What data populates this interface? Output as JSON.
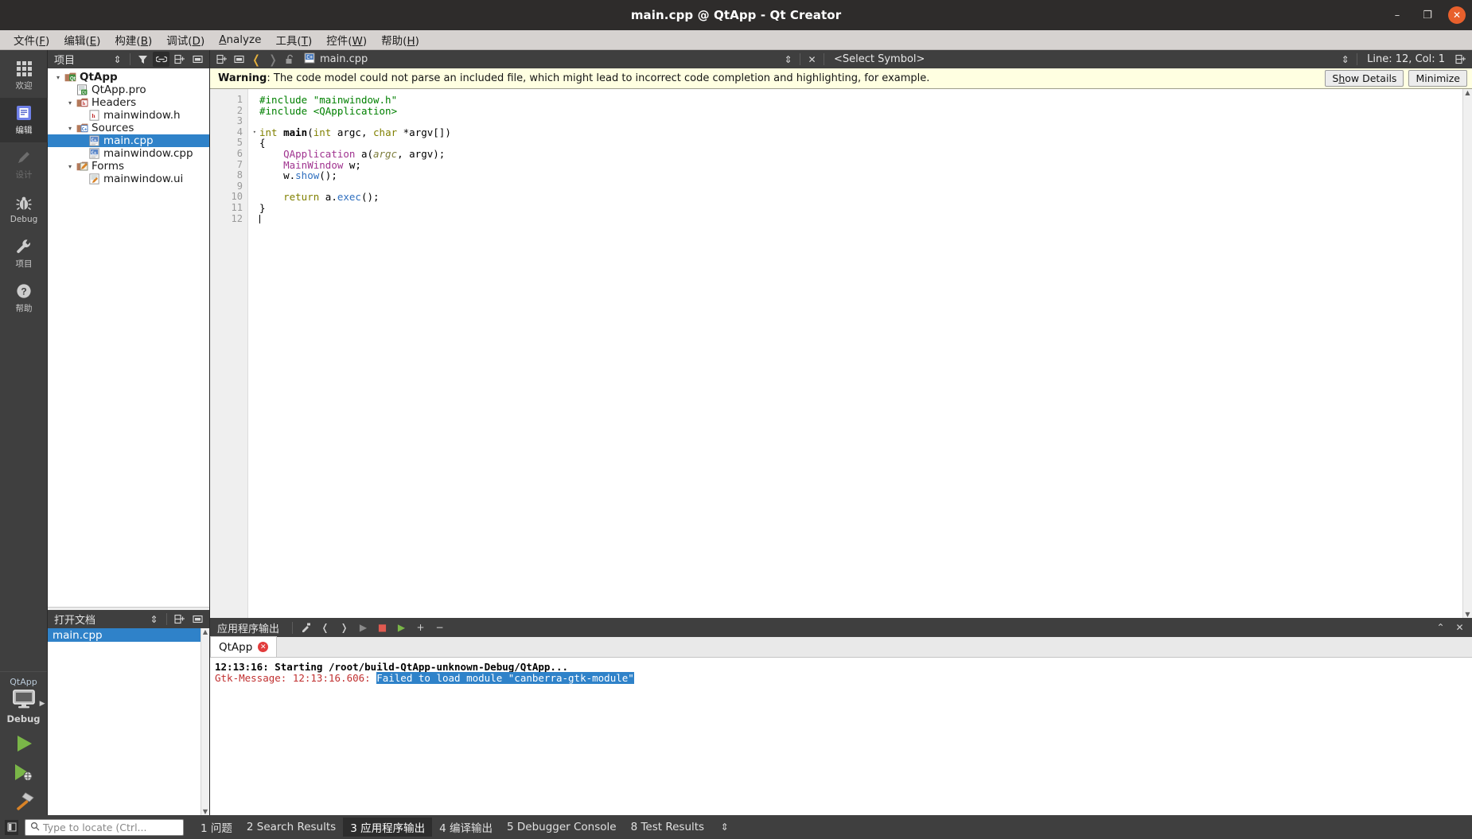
{
  "window": {
    "title": "main.cpp @ QtApp - Qt Creator",
    "minimize": "–",
    "maximize": "❐",
    "close": "✕"
  },
  "menubar": {
    "items": [
      {
        "pre": "文件(",
        "key": "F",
        "post": ")"
      },
      {
        "pre": "编辑(",
        "key": "E",
        "post": ")"
      },
      {
        "pre": "构建(",
        "key": "B",
        "post": ")"
      },
      {
        "pre": "调试(",
        "key": "D",
        "post": ")"
      },
      {
        "pre": "",
        "key": "A",
        "post": "nalyze"
      },
      {
        "pre": "工具(",
        "key": "T",
        "post": ")"
      },
      {
        "pre": "控件(",
        "key": "W",
        "post": ")"
      },
      {
        "pre": "帮助(",
        "key": "H",
        "post": ")"
      }
    ]
  },
  "modebar": {
    "modes": [
      {
        "label": "欢迎",
        "icon": "grid-icon",
        "state": "normal"
      },
      {
        "label": "编辑",
        "icon": "edit-document-icon",
        "state": "active"
      },
      {
        "label": "设计",
        "icon": "pencil-icon",
        "state": "disabled"
      },
      {
        "label": "Debug",
        "icon": "bug-icon",
        "state": "normal"
      },
      {
        "label": "项目",
        "icon": "wrench-icon",
        "state": "normal"
      },
      {
        "label": "帮助",
        "icon": "question-circle-icon",
        "state": "normal"
      }
    ],
    "kit": {
      "project_name": "QtApp",
      "build_config": "Debug",
      "target_icon": "monitor-icon",
      "run_icon": "run-play-icon",
      "debug_icon": "debug-play-icon",
      "build_icon": "hammer-icon"
    }
  },
  "project_dock": {
    "title": "项目",
    "toolbar": [
      {
        "name": "filter-sort-icon",
        "glyph": "⇕",
        "on": false
      },
      {
        "name": "filter-icon",
        "glyph": "▼",
        "on": false
      },
      {
        "name": "link-with-editor-icon",
        "glyph": "⛓",
        "on": true
      },
      {
        "name": "split-icon",
        "glyph": "⊟",
        "on": false
      },
      {
        "name": "close-dock-icon",
        "glyph": "⊡",
        "on": false
      }
    ],
    "tree": [
      {
        "label": "QtApp",
        "depth": 0,
        "twisty": "▾",
        "icon": "qt-project-icon",
        "bold": true,
        "selected": false
      },
      {
        "label": "QtApp.pro",
        "depth": 1,
        "twisty": "",
        "icon": "pro-file-icon",
        "bold": false,
        "selected": false
      },
      {
        "label": "Headers",
        "depth": 1,
        "twisty": "▾",
        "icon": "headers-folder-icon",
        "bold": false,
        "selected": false
      },
      {
        "label": "mainwindow.h",
        "depth": 2,
        "twisty": "",
        "icon": "header-file-icon",
        "bold": false,
        "selected": false
      },
      {
        "label": "Sources",
        "depth": 1,
        "twisty": "▾",
        "icon": "sources-folder-icon",
        "bold": false,
        "selected": false
      },
      {
        "label": "main.cpp",
        "depth": 2,
        "twisty": "",
        "icon": "cpp-file-icon",
        "bold": false,
        "selected": true
      },
      {
        "label": "mainwindow.cpp",
        "depth": 2,
        "twisty": "",
        "icon": "cpp-file-icon",
        "bold": false,
        "selected": false
      },
      {
        "label": "Forms",
        "depth": 1,
        "twisty": "▾",
        "icon": "forms-folder-icon",
        "bold": false,
        "selected": false
      },
      {
        "label": "mainwindow.ui",
        "depth": 2,
        "twisty": "",
        "icon": "ui-file-icon",
        "bold": false,
        "selected": false
      }
    ]
  },
  "open_documents": {
    "title": "打开文档",
    "toolbar": [
      {
        "name": "sort-icon",
        "glyph": "⇕"
      },
      {
        "name": "split-icon",
        "glyph": "⊟"
      },
      {
        "name": "close-dock-icon",
        "glyph": "⊡"
      }
    ],
    "items": [
      {
        "label": "main.cpp",
        "selected": true
      }
    ]
  },
  "editor_toolbar": {
    "split_icon": "⊟",
    "close_split_icon": "⊡",
    "back_icon": "❬",
    "forward_icon": "❭",
    "lock_icon": "lock-open-icon",
    "file_icon": "cpp-file-icon",
    "filename": "main.cpp",
    "file_dropdown_icon": "⇕",
    "close_file_icon": "✕",
    "symbol_selector": "<Select Symbol>",
    "symbol_dropdown_icon": "⇕",
    "line_col": "Line: 12, Col: 1",
    "split_right_icon": "⊟"
  },
  "warning_bar": {
    "label": "Warning",
    "colon": ":",
    "message": "The code model could not parse an included file, which might lead to incorrect code completion and highlighting, for example.",
    "show_details_pre": "S",
    "show_details_key": "h",
    "show_details_post": "ow Details",
    "minimize_label": "Minimize"
  },
  "code": {
    "filename": "main.cpp",
    "line_numbers": [
      "1",
      "2",
      "3",
      "4",
      "5",
      "6",
      "7",
      "8",
      "9",
      "10",
      "11",
      "12"
    ],
    "fold_marker_line": 4,
    "fold_glyph": "▾",
    "cursor_line": 12,
    "lines": [
      {
        "n": 1,
        "tokens": [
          {
            "t": "#include ",
            "c": "pre"
          },
          {
            "t": "\"mainwindow.h\"",
            "c": "str"
          }
        ]
      },
      {
        "n": 2,
        "tokens": [
          {
            "t": "#include ",
            "c": "pre"
          },
          {
            "t": "<QApplication>",
            "c": "str"
          }
        ]
      },
      {
        "n": 3,
        "tokens": []
      },
      {
        "n": 4,
        "tokens": [
          {
            "t": "int ",
            "c": "kw"
          },
          {
            "t": "main",
            "c": "fn"
          },
          {
            "t": "(",
            "c": "pl"
          },
          {
            "t": "int",
            "c": "kw"
          },
          {
            "t": " argc, ",
            "c": "pl"
          },
          {
            "t": "char",
            "c": "kw"
          },
          {
            "t": " *argv[])",
            "c": "pl"
          }
        ]
      },
      {
        "n": 5,
        "tokens": [
          {
            "t": "{",
            "c": "pl"
          }
        ]
      },
      {
        "n": 6,
        "tokens": [
          {
            "t": "    ",
            "c": "pl"
          },
          {
            "t": "QApplication",
            "c": "typ"
          },
          {
            "t": " a(",
            "c": "pl"
          },
          {
            "t": "argc",
            "c": "par"
          },
          {
            "t": ", argv);",
            "c": "pl"
          }
        ]
      },
      {
        "n": 7,
        "tokens": [
          {
            "t": "    ",
            "c": "pl"
          },
          {
            "t": "MainWindow",
            "c": "typ"
          },
          {
            "t": " w;",
            "c": "pl"
          }
        ]
      },
      {
        "n": 8,
        "tokens": [
          {
            "t": "    w.",
            "c": "pl"
          },
          {
            "t": "show",
            "c": "meth"
          },
          {
            "t": "();",
            "c": "pl"
          }
        ]
      },
      {
        "n": 9,
        "tokens": []
      },
      {
        "n": 10,
        "tokens": [
          {
            "t": "    ",
            "c": "pl"
          },
          {
            "t": "return",
            "c": "kw"
          },
          {
            "t": " a.",
            "c": "pl"
          },
          {
            "t": "exec",
            "c": "meth"
          },
          {
            "t": "();",
            "c": "pl"
          }
        ]
      },
      {
        "n": 11,
        "tokens": [
          {
            "t": "}",
            "c": "pl"
          }
        ]
      },
      {
        "n": 12,
        "tokens": []
      }
    ]
  },
  "output_pane": {
    "title": "应用程序输出",
    "toolbar": [
      {
        "name": "filter-output-icon",
        "glyph": "⚗"
      },
      {
        "name": "prev-item-icon",
        "glyph": "❬"
      },
      {
        "name": "next-item-icon",
        "glyph": "❭"
      },
      {
        "name": "run-icon",
        "glyph": "▶"
      },
      {
        "name": "stop-icon",
        "glyph": "■"
      },
      {
        "name": "attach-debugger-icon",
        "glyph": "▶"
      },
      {
        "name": "zoom-in-icon",
        "glyph": "+"
      },
      {
        "name": "zoom-out-icon",
        "glyph": "−"
      }
    ],
    "right_toolbar": [
      {
        "name": "maximize-output-icon",
        "glyph": "⌃"
      },
      {
        "name": "close-output-icon",
        "glyph": "✕"
      }
    ],
    "tabs": [
      {
        "label": "QtApp",
        "close_glyph": "✕",
        "active": true
      }
    ],
    "lines": [
      {
        "style": "bold",
        "text": "12:13:16: Starting /root/build-QtApp-unknown-Debug/QtApp..."
      },
      {
        "style": "error",
        "prefix": "Gtk-Message: 12:13:16.606: ",
        "highlight": "Failed to load module \"canberra-gtk-module\""
      }
    ]
  },
  "statusbar": {
    "sidebar_toggle_icon": "▯",
    "locator": {
      "search_icon": "search-icon",
      "placeholder": "Type to locate (Ctrl...",
      "value": ""
    },
    "tabs": [
      {
        "num": "1",
        "label": "问题",
        "active": false
      },
      {
        "num": "2",
        "label": "Search Results",
        "active": false
      },
      {
        "num": "3",
        "label": "应用程序输出",
        "active": true
      },
      {
        "num": "4",
        "label": "编译输出",
        "active": false
      },
      {
        "num": "5",
        "label": "Debugger Console",
        "active": false
      },
      {
        "num": "8",
        "label": "Test Results",
        "active": false
      }
    ],
    "more_icon": "⇕"
  },
  "colors": {
    "titlebar_bg": "#2e2c2b",
    "close_btn": "#e8602c",
    "menubar_bg": "#d6d2d0",
    "dock_header_bg": "#3f3f3f",
    "selection_blue": "#2f82c9",
    "warning_bg": "#ffffe1",
    "error_red": "#c03030",
    "run_green": "#7ab648"
  }
}
